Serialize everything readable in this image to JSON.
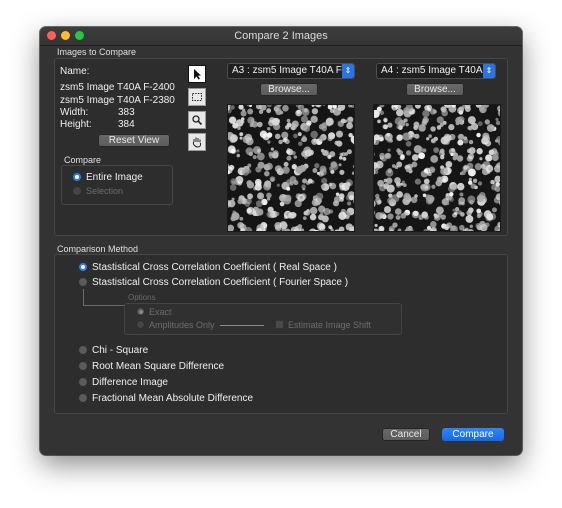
{
  "window": {
    "title": "Compare 2 Images"
  },
  "images_group": {
    "label": "Images to Compare",
    "name_label": "Name:",
    "name1": "zsm5 Image T40A F-2400",
    "name2": "zsm5 Image T40A F-2380",
    "width_label": "Width:",
    "width_value": "383",
    "height_label": "Height:",
    "height_value": "384",
    "reset_label": "Reset View",
    "compare_label": "Compare",
    "opt_entire": "Entire Image",
    "opt_selection": "Selection"
  },
  "tools": [
    "arrow-tool",
    "marquee-tool",
    "zoom-tool",
    "hand-tool"
  ],
  "image_a": {
    "popup": "A3 : zsm5 Image T40A F",
    "browse": "Browse..."
  },
  "image_b": {
    "popup": "A4 : zsm5 Image T40A",
    "browse": "Browse..."
  },
  "method_group": {
    "label": "Comparison Method",
    "opt_real": "Stastistical Cross Correlation Coefficient ( Real Space )",
    "opt_fourier": "Stastistical Cross Correlation Coefficient ( Fourier Space )",
    "options_label": "Options",
    "opt_exact": "Exact",
    "opt_amplitudes": "Amplitudes Only",
    "estimate_shift": "Estimate Image Shift",
    "opt_chi": "Chi - Square",
    "opt_rms": "Root Mean Square Difference",
    "opt_diff": "Difference Image",
    "opt_fmad": "Fractional Mean Absolute Difference"
  },
  "footer": {
    "cancel": "Cancel",
    "compare": "Compare"
  },
  "colors": {
    "accent": "#2d7df6",
    "window_bg": "#333333"
  }
}
